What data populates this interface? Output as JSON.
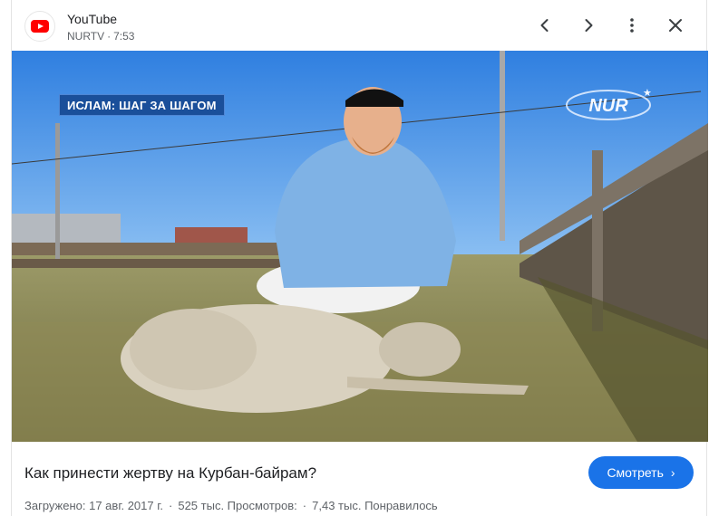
{
  "header": {
    "source_name": "YouTube",
    "channel": "NURTV",
    "duration": "7:53",
    "icons": {
      "prev": "chevron-left-icon",
      "next": "chevron-right-icon",
      "more": "more-vert-icon",
      "close": "close-icon"
    }
  },
  "image": {
    "overlay_caption": "ИСЛАМ: ШАГ ЗА ШАГОМ",
    "watermark": "NUR"
  },
  "video": {
    "title": "Как принести жертву на Курбан-байрам?",
    "watch_label": "Смотреть",
    "upload_label": "Загружено: 17 авг. 2017 г.",
    "views_label": "525 тыс. Просмотров:",
    "likes_label": "7,43 тыс. Понравилось"
  },
  "colors": {
    "accent": "#1a73e8",
    "youtube_red": "#ff0000"
  }
}
